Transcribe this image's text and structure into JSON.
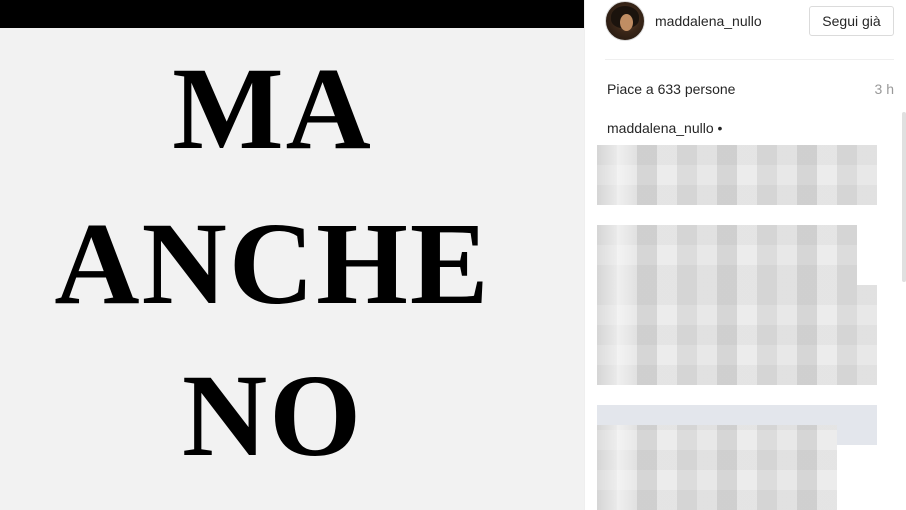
{
  "post": {
    "lines": [
      "MA",
      "ANCHE",
      "NO"
    ]
  },
  "header": {
    "username": "maddalena_nullo",
    "follow_label": "Segui già"
  },
  "stats": {
    "likes_text": "Piace a 633 persone",
    "time_text": "3 h"
  },
  "caption": {
    "username": "maddalena_nullo",
    "separator": "•"
  }
}
